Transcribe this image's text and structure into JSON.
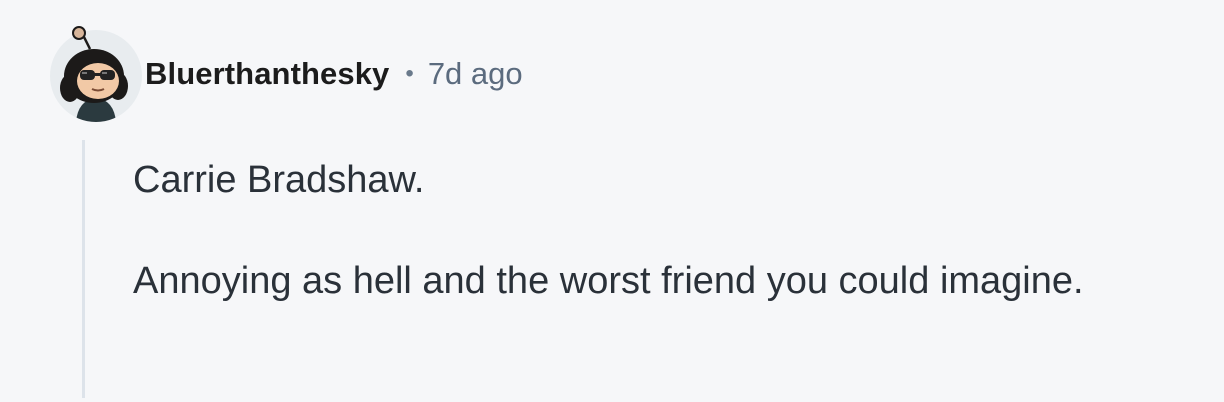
{
  "comment": {
    "author": {
      "username": "Bluerthanthesky",
      "avatar_icon": "snoo-avatar-icon"
    },
    "separator": "•",
    "timestamp": "7d ago",
    "paragraphs": [
      "Carrie Bradshaw.",
      "Annoying as hell and the worst friend you could imagine."
    ]
  },
  "colors": {
    "background": "#f6f7f9",
    "username": "#1c1c1c",
    "timestamp": "#5b6b7e",
    "body_text": "#2a3139",
    "thread_line": "#dde3ea"
  }
}
